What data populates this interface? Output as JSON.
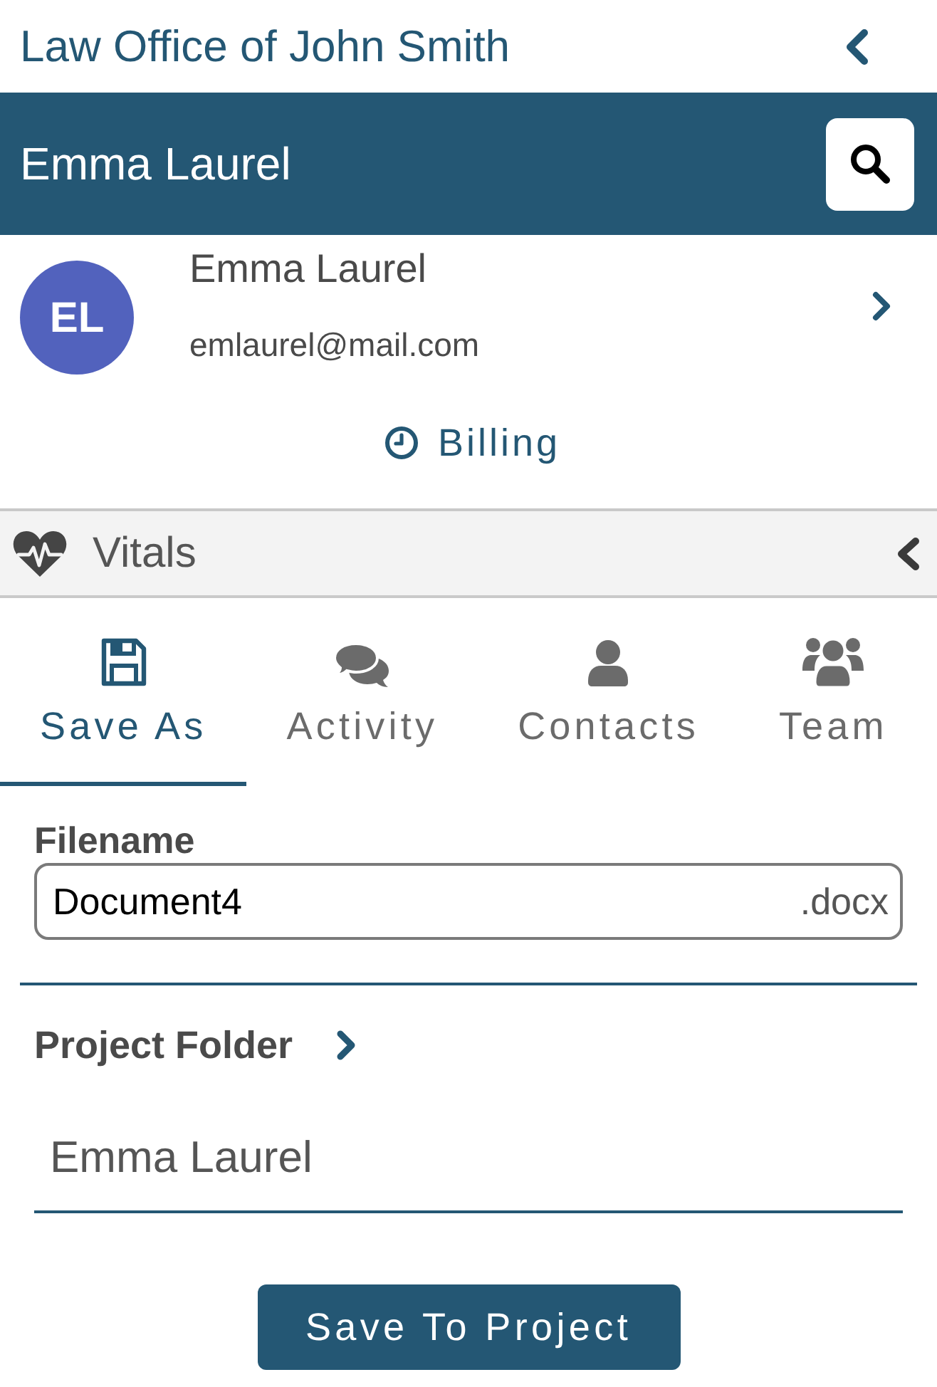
{
  "header": {
    "title": "Law Office of John Smith"
  },
  "client_bar": {
    "name": "Emma Laurel"
  },
  "contact": {
    "initials": "EL",
    "name": "Emma Laurel",
    "email": "emlaurel@mail.com"
  },
  "billing": {
    "label": "Billing"
  },
  "vitals": {
    "label": "Vitals",
    "expanded": false
  },
  "tabs": [
    {
      "label": "Save As",
      "selected": true
    },
    {
      "label": "Activity",
      "selected": false
    },
    {
      "label": "Contacts",
      "selected": false
    },
    {
      "label": "Team",
      "selected": false
    }
  ],
  "save_form": {
    "filename": {
      "label": "Filename",
      "value": "Document4",
      "extension": ".docx"
    },
    "project_folder": {
      "label": "Project Folder",
      "value": "Emma Laurel"
    },
    "button": "Save To Project"
  }
}
